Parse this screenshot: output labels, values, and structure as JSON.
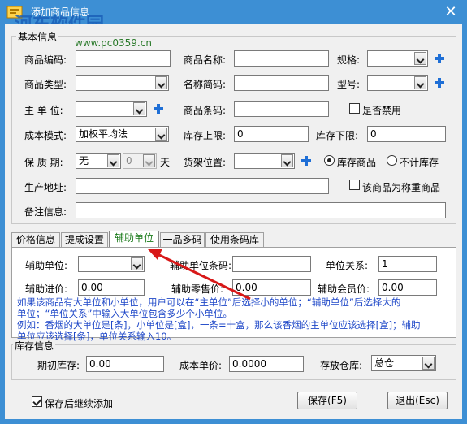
{
  "window": {
    "title": "添加商品信息",
    "watermark": "河东软件园",
    "watermark_url": "www.pc0359.cn",
    "close_symbol": "✕"
  },
  "basic": {
    "group_label": "基本信息",
    "code_label": "商品编码:",
    "code_value": "",
    "name_label": "商品名称:",
    "name_value": "",
    "spec_label": "规格:",
    "spec_value": "",
    "type_label": "商品类型:",
    "type_value": "",
    "short_label": "名称简码:",
    "short_value": "",
    "model_label": "型号:",
    "model_value": "",
    "unit_label": "主 单 位:",
    "unit_value": "",
    "barcode_label": "商品条码:",
    "barcode_value": "",
    "disabled_label": "是否禁用",
    "disabled_checked": false,
    "cost_label": "成本模式:",
    "cost_value": "加权平均法",
    "upper_label": "库存上限:",
    "upper_value": "0",
    "lower_label": "库存下限:",
    "lower_value": "0",
    "shelf_label": "保 质 期:",
    "shelf_select_value": "无",
    "shelf_num_value": "0",
    "shelf_unit": "天",
    "location_label": "货架位置:",
    "location_value": "",
    "radio_stock_label": "库存商品",
    "radio_nonstock_label": "不计库存",
    "stock_selected": true,
    "address_label": "生产地址:",
    "address_value": "",
    "weigh_label": "该商品为称重商品",
    "weigh_checked": false,
    "remark_label": "备注信息:",
    "remark_value": ""
  },
  "tabs": [
    {
      "label": "价格信息"
    },
    {
      "label": "提成设置"
    },
    {
      "label": "辅助单位"
    },
    {
      "label": "一品多码"
    },
    {
      "label": "使用条码库"
    }
  ],
  "aux": {
    "unit_label": "辅助单位:",
    "unit_value": "",
    "barcode_label": "辅助单位条码:",
    "barcode_value": "",
    "relation_label": "单位关系:",
    "relation_value": "1",
    "purchase_label": "辅助进价:",
    "purchase_value": "0.00",
    "retail_label": "辅助零售价:",
    "retail_value": "0.00",
    "member_label": "辅助会员价:",
    "member_value": "0.00",
    "note_lines": [
      "如果该商品有大单位和小单位，用户可以在“主单位”后选择小的单位；“辅助单位”后选择大的",
      "单位；“单位关系”中输入大单位包含多少个小单位。",
      "例如：香烟的大单位是[条]，小单位是[盒]，一条=十盒，那么该香烟的主单位应该选择[盒]；辅助",
      "单位应该选择[条]，单位关系输入10。"
    ]
  },
  "stock": {
    "group_label": "库存信息",
    "initial_label": "期初库存:",
    "initial_value": "0.00",
    "cost_label": "成本单价:",
    "cost_value": "0.0000",
    "warehouse_label": "存放仓库:",
    "warehouse_value": "总仓"
  },
  "footer": {
    "continue_label": "保存后继续添加",
    "continue_checked": true,
    "save_label": "保存(F5)",
    "exit_label": "退出(Esc)"
  },
  "colors": {
    "title_bar": "#3d8fd4",
    "plus_icon": "#1f6fd6",
    "note_text": "#1f48c8",
    "annotation_arrow": "#d81818",
    "active_tab_text": "#1a7a1a"
  }
}
